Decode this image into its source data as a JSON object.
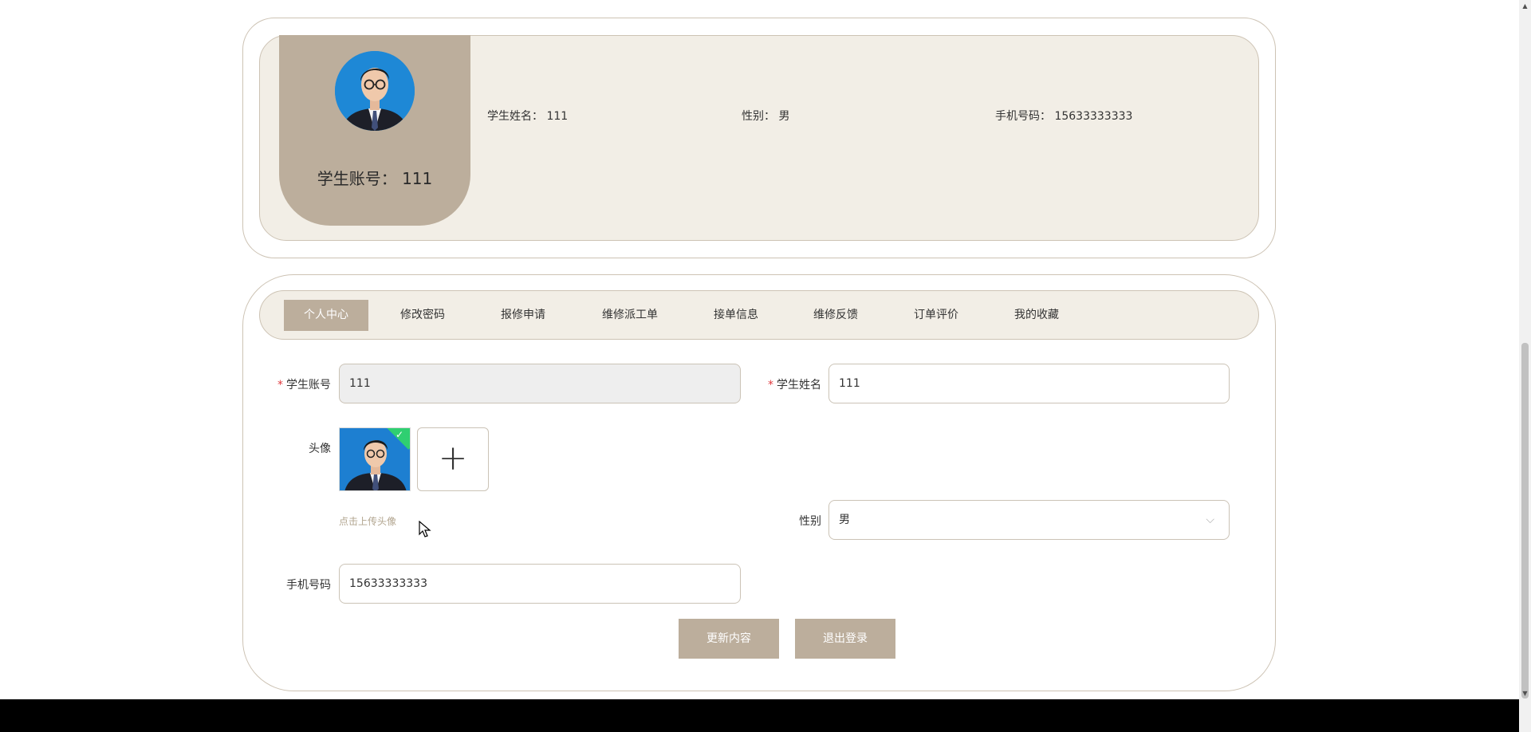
{
  "profile": {
    "account_label": "学生账号：",
    "account_value": "111",
    "name_label": "学生姓名：",
    "name_value": "111",
    "gender_label": "性别：",
    "gender_value": "男",
    "phone_label": "手机号码：",
    "phone_value": "15633333333"
  },
  "tabs": [
    {
      "label": "个人中心",
      "active": true
    },
    {
      "label": "修改密码"
    },
    {
      "label": "报修申请"
    },
    {
      "label": "维修派工单"
    },
    {
      "label": "接单信息"
    },
    {
      "label": "维修反馈"
    },
    {
      "label": "订单评价"
    },
    {
      "label": "我的收藏"
    }
  ],
  "form": {
    "account_label": "学生账号",
    "account_value": "111",
    "name_label": "学生姓名",
    "name_value": "111",
    "avatar_label": "头像",
    "upload_hint": "点击上传头像",
    "gender_label": "性别",
    "gender_value": "男",
    "phone_label": "手机号码",
    "phone_value": "15633333333",
    "required_mark": "*",
    "upload_icon": "plus-icon"
  },
  "buttons": {
    "update": "更新内容",
    "logout": "退出登录"
  },
  "colors": {
    "accent": "#bcae9c",
    "panel_bg": "#f2eee6",
    "border": "#cdc3b4",
    "required": "#e0393e",
    "upload_success": "#2fcf71"
  }
}
